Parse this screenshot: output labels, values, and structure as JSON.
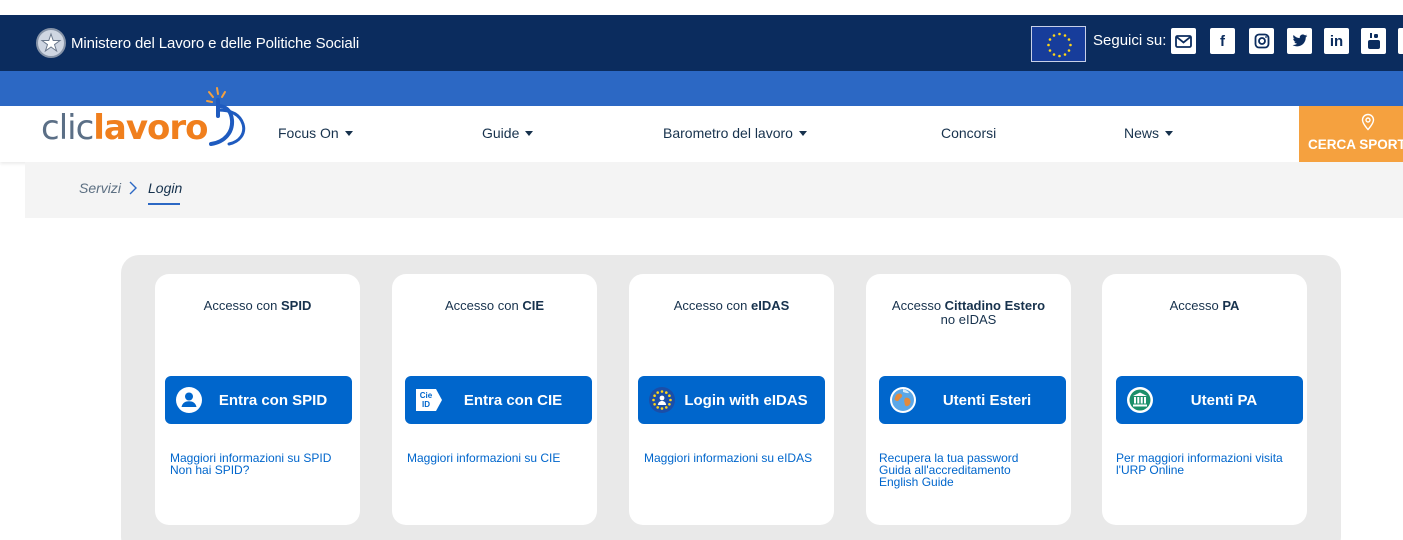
{
  "header": {
    "ministry_name": "Ministero del Lavoro e delle Politiche Sociali",
    "follow_label": "Seguici su:",
    "social_icons": [
      "mail-icon",
      "facebook-icon",
      "instagram-icon",
      "twitter-icon",
      "linkedin-icon",
      "youtube-icon"
    ],
    "social_glyphs": {
      "facebook": "f",
      "linkedin": "in"
    }
  },
  "logo": {
    "part1": "clic",
    "part2": "lavoro"
  },
  "nav": {
    "items": [
      {
        "label": "Focus On",
        "dropdown": true
      },
      {
        "label": "Guide",
        "dropdown": true
      },
      {
        "label": "Barometro del lavoro",
        "dropdown": true
      },
      {
        "label": "Concorsi",
        "dropdown": false
      },
      {
        "label": "News",
        "dropdown": true
      }
    ],
    "cta_label": "CERCA SPORTE"
  },
  "breadcrumb": {
    "parent": "Servizi",
    "current": "Login"
  },
  "cards": [
    {
      "title_prefix": "Accesso con ",
      "title_bold": "SPID",
      "title_suffix": "",
      "subtitle": "",
      "button_label": "Entra con SPID",
      "button_icon": "user-icon",
      "links": [
        "Maggiori informazioni su SPID",
        "Non hai SPID?"
      ]
    },
    {
      "title_prefix": "Accesso con ",
      "title_bold": "CIE",
      "title_suffix": "",
      "subtitle": "",
      "button_label": "Entra con CIE",
      "button_icon": "cie-id-icon",
      "button_icon_text": "Cie ID",
      "links": [
        "Maggiori informazioni su CIE"
      ]
    },
    {
      "title_prefix": "Accesso con ",
      "title_bold": "eIDAS",
      "title_suffix": "",
      "subtitle": "",
      "button_label": "Login with eIDAS",
      "button_icon": "eu-stars-icon",
      "links": [
        "Maggiori informazioni su eIDAS"
      ]
    },
    {
      "title_prefix": "Accesso ",
      "title_bold": "Cittadino Estero",
      "title_suffix": "",
      "subtitle": "no eIDAS",
      "button_label": "Utenti Esteri",
      "button_icon": "globe-icon",
      "links": [
        "Recupera la tua password",
        "Guida all'accreditamento",
        "English Guide"
      ]
    },
    {
      "title_prefix": "Accesso ",
      "title_bold": "PA",
      "title_suffix": "",
      "subtitle": "",
      "button_label": "Utenti PA",
      "button_icon": "government-building-icon",
      "links": [
        "Per maggiori informazioni visita l'URP Online"
      ]
    }
  ],
  "colors": {
    "top_bar": "#0b2c5e",
    "stripe": "#2c68c4",
    "primary_button": "#0066cc",
    "logo_orange": "#f07f1d",
    "cta_orange": "#f5a13f"
  }
}
